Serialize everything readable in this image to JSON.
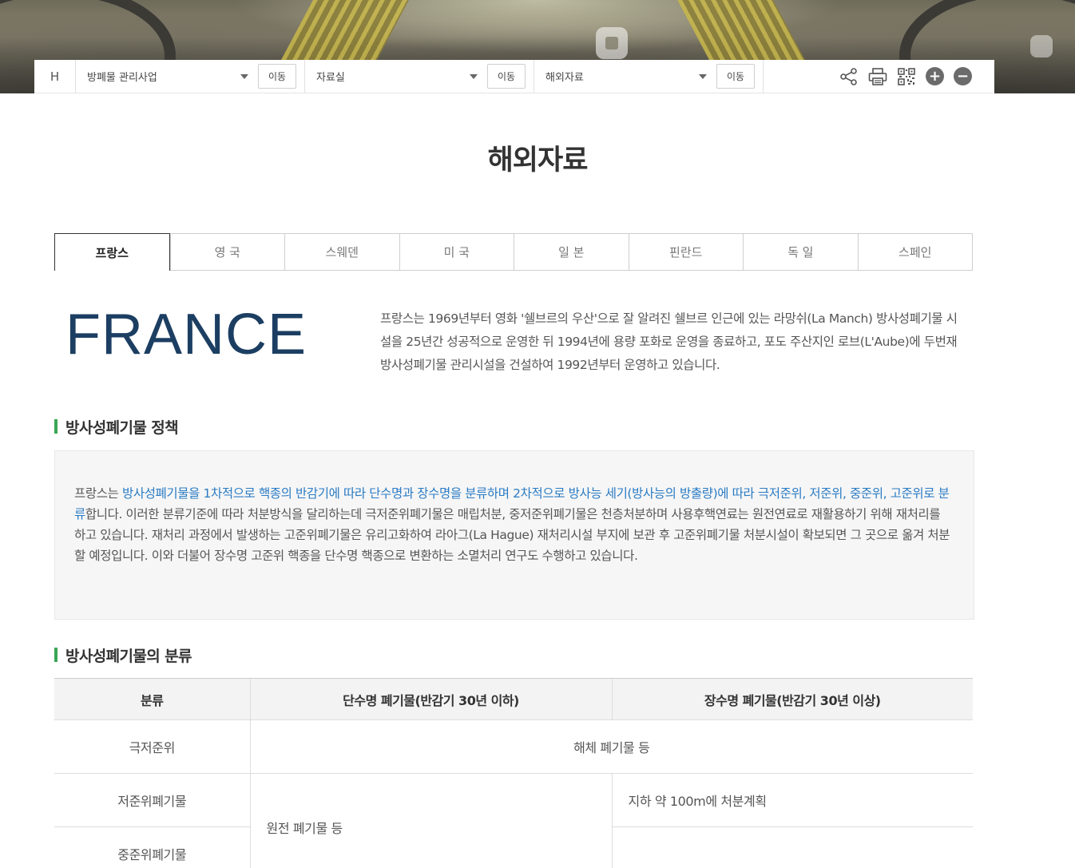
{
  "locbar": {
    "home": "H",
    "groups": [
      {
        "selected": "방폐물 관리사업",
        "button": "이동"
      },
      {
        "selected": "자료실",
        "button": "이동"
      },
      {
        "selected": "해외자료",
        "button": "이동"
      }
    ],
    "tools": [
      "share-icon",
      "print-icon",
      "qr-code-icon",
      "zoom-in-icon",
      "zoom-out-icon"
    ],
    "zoom_in": "+",
    "zoom_out": "−"
  },
  "page_title": "해외자료",
  "tabs": [
    {
      "label": "프랑스",
      "active": true
    },
    {
      "label": "영 국"
    },
    {
      "label": "스웨덴"
    },
    {
      "label": "미 국"
    },
    {
      "label": "일 본"
    },
    {
      "label": "핀란드"
    },
    {
      "label": "독 일"
    },
    {
      "label": "스페인"
    }
  ],
  "country": {
    "name_en": "FRANCE",
    "intro": "프랑스는 1969년부터 영화 '쉘브르의 우산'으로 잘 알려진 쉘브르 인근에 있는 라망쉬(La Manch) 방사성폐기물 시설을 25년간 성공적으로 운영한 뒤 1994년에 용량 포화로 운영을 종료하고, 포도 주산지인 로브(L'Aube)에 두번재 방사성폐기물 관리시설을 건설하여 1992년부터 운영하고 있습니다."
  },
  "policy": {
    "heading": "방사성폐기물 정책",
    "text_prefix": "프랑스는 ",
    "text_highlight": "방사성폐기물을 1차적으로 핵종의 반감기에 따라 단수명과 장수명을 분류하며 2차적으로 방사능 세기(방사능의 방출량)에 따라 극저준위, 저준위, 중준위, 고준위로 분류",
    "text_rest": "합니다. 이러한 분류기준에 따라 처분방식을 달리하는데 극저준위폐기물은 매립처분, 중저준위폐기물은 천층처분하며 사용후핵연료는 원전연료로 재활용하기 위해 재처리를 하고 있습니다. 재처리 과정에서 발생하는 고준위폐기물은 유리고화하여 라아그(La Hague) 재처리시설 부지에 보관 후 고준위폐기물 처분시설이 확보되면 그 곳으로 옮겨 처분할 예정입니다. 이와 더불어 장수명 고준위 핵종을 단수명 핵종으로 변환하는 소멸처리 연구도 수행하고 있습니다."
  },
  "classification": {
    "heading": "방사성폐기물의 분류",
    "headers": [
      "분류",
      "단수명 폐기물(반감기 30년 이하)",
      "장수명 폐기물(반감기 30년 이상)"
    ],
    "rows": {
      "vllw": {
        "label": "극저준위",
        "both": "해체 폐기물 등"
      },
      "llw": {
        "label": "저준위폐기물",
        "long": "지하 약 100m에 처분계획"
      },
      "ilw": {
        "label": "중준위폐기물"
      },
      "short_llw_ilw": "원전 폐기물 등"
    }
  }
}
